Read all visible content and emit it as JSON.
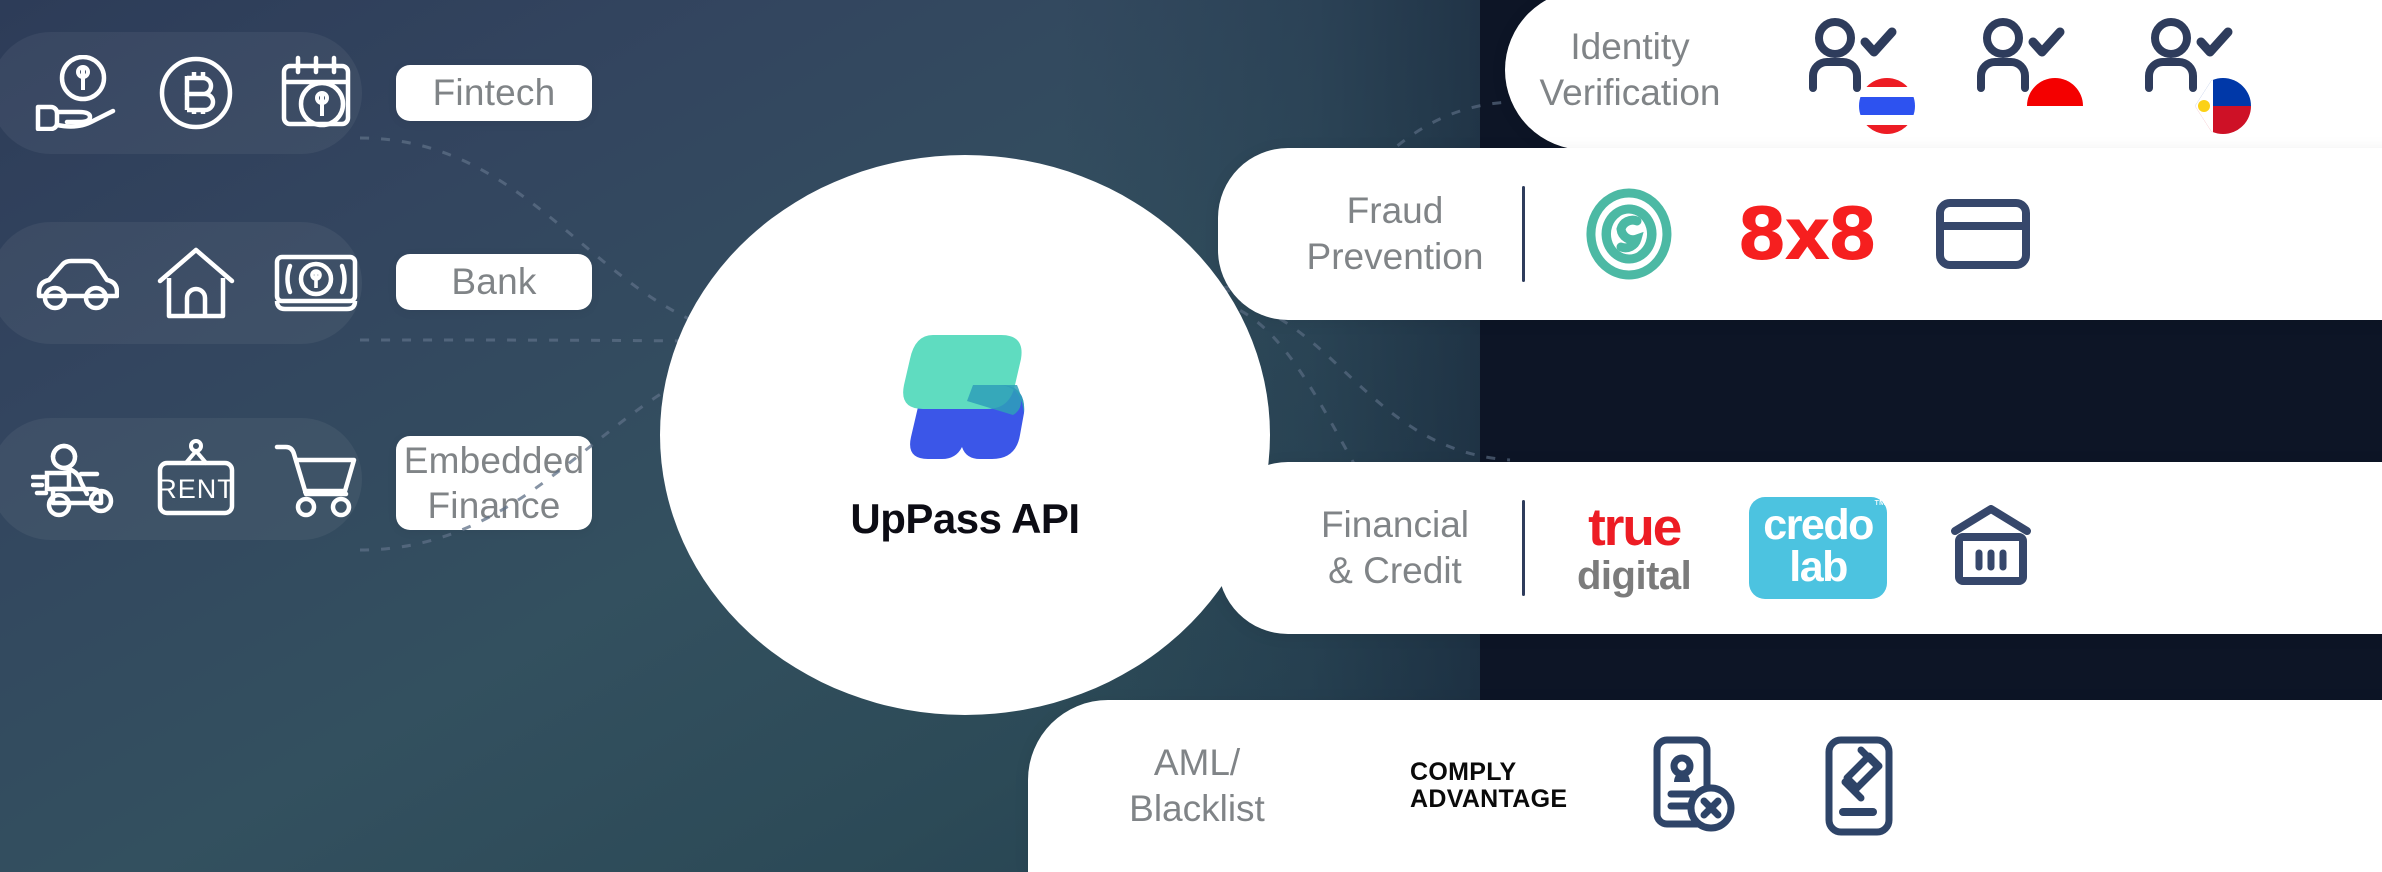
{
  "hub": {
    "title": "UpPass API",
    "logo_colors": {
      "mint": "#5fdcc0",
      "blue": "#3b56e8",
      "overlap": "#2f9fb8"
    }
  },
  "left": {
    "segments": [
      {
        "label": "Fintech",
        "icons": [
          "hand-holding-dollar-icon",
          "bitcoin-icon",
          "calendar-dollar-icon"
        ]
      },
      {
        "label": "Bank",
        "icons": [
          "car-icon",
          "house-icon",
          "banknote-dollar-icon"
        ]
      },
      {
        "label": "Embedded\nFinance",
        "label_lines": [
          "Embedded",
          "Finance"
        ],
        "icons": [
          "delivery-scooter-icon",
          "rent-sign-icon",
          "shopping-cart-icon"
        ]
      }
    ]
  },
  "right": {
    "cards": [
      {
        "category_lines": [
          "Identity",
          "Verification"
        ],
        "partners": [
          {
            "name": "user-check-thailand",
            "type": "flag-user",
            "flag": "thailand"
          },
          {
            "name": "user-check-indonesia",
            "type": "flag-user",
            "flag": "indonesia"
          },
          {
            "name": "user-check-philippines",
            "type": "flag-user",
            "flag": "philippines"
          }
        ]
      },
      {
        "category_lines": [
          "Fraud",
          "Prevention"
        ],
        "partners": [
          {
            "name": "sumsub-logo",
            "type": "mark"
          },
          {
            "name": "8x8-logo",
            "type": "wordmark",
            "text": "8x8",
            "color": "#f61f1f"
          },
          {
            "name": "credit-card-icon",
            "type": "icon"
          }
        ]
      },
      {
        "category_lines": [
          "Financial",
          "& Credit"
        ],
        "partners": [
          {
            "name": "true-digital-logo",
            "type": "wordmark",
            "line1": "true",
            "line2": "digital",
            "color1": "#ed1c24",
            "color2": "#7b7b7b"
          },
          {
            "name": "credolab-logo",
            "type": "wordmark",
            "line1": "credo",
            "line2": "lab",
            "bg": "#4cc3e0"
          },
          {
            "name": "bank-building-icon",
            "type": "icon"
          }
        ]
      },
      {
        "category_lines": [
          "AML/",
          "Blacklist"
        ],
        "partners": [
          {
            "name": "comply-advantage-logo",
            "type": "wordmark",
            "line1": "COMPLY",
            "line2": "ADVANTAGE"
          },
          {
            "name": "id-card-blocked-icon",
            "type": "icon"
          },
          {
            "name": "gavel-document-icon",
            "type": "icon"
          }
        ]
      }
    ]
  },
  "colors": {
    "navy": "#2e3c5c",
    "left_bg_start": "#2d3c58",
    "left_bg_end": "#24404f",
    "label_text": "#808487",
    "card_bg": "#ffffff"
  }
}
